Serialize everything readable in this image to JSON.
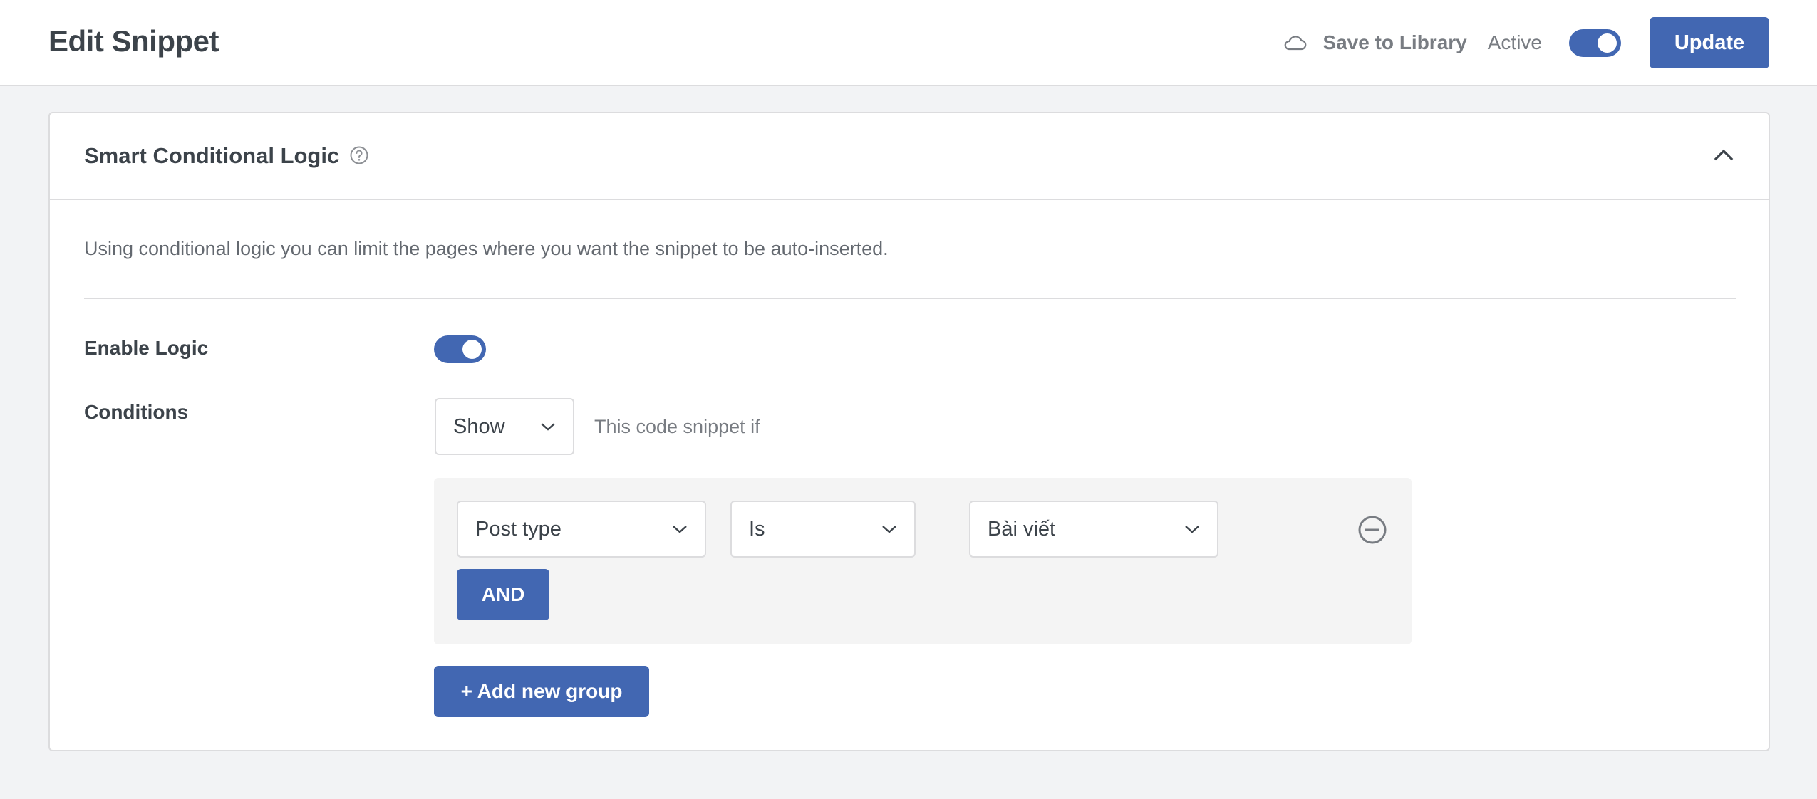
{
  "header": {
    "title": "Edit Snippet",
    "save_to_library_label": "Save to Library",
    "save_to_library_icon": "cloud-icon",
    "active_label": "Active",
    "active_toggle_on": true,
    "update_label": "Update"
  },
  "colors": {
    "accent": "#4267b2",
    "text_primary": "#3c434a",
    "text_muted": "#646970",
    "border": "#dcdcde",
    "page_background": "#f2f3f5",
    "group_background": "#f4f4f4"
  },
  "panel": {
    "title": "Smart Conditional Logic",
    "help_icon": "question-circle-icon",
    "collapse_icon": "chevron-up-icon",
    "description": "Using conditional logic you can limit the pages where you want the snippet to be auto-inserted.",
    "enable_logic": {
      "label": "Enable Logic",
      "on": true
    },
    "conditions": {
      "label": "Conditions",
      "mode_select": {
        "value": "Show"
      },
      "mode_suffix": "This code snippet if",
      "groups": [
        {
          "rules": [
            {
              "type": "Post type",
              "operator": "Is",
              "value": "Bài viết",
              "remove_icon": "minus-circle-icon"
            }
          ],
          "and_label": "AND"
        }
      ],
      "add_group_label": "+ Add new group"
    }
  }
}
